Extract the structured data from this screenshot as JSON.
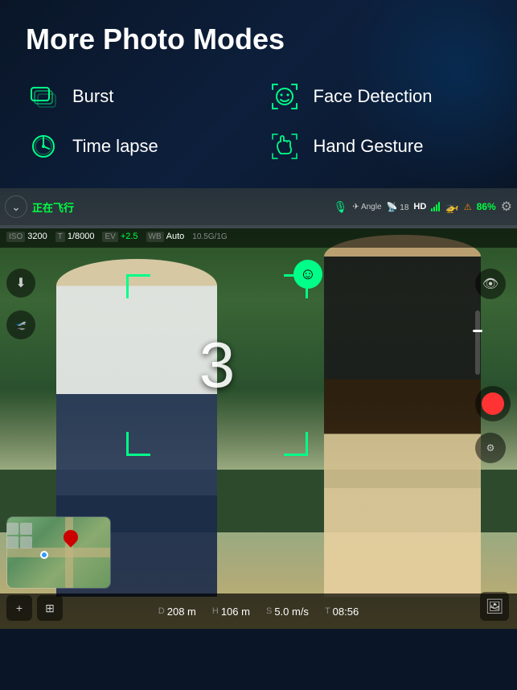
{
  "header": {
    "title": "More Photo Modes"
  },
  "modes": [
    {
      "id": "burst",
      "label": "Burst",
      "icon": "burst-icon",
      "iconColor": "#00ff88"
    },
    {
      "id": "face-detection",
      "label": "Face Detection",
      "icon": "face-detection-icon",
      "iconColor": "#00ff88"
    },
    {
      "id": "time-lapse",
      "label": "Time lapse",
      "icon": "time-lapse-icon",
      "iconColor": "#00ff88"
    },
    {
      "id": "hand-gesture",
      "label": "Hand Gesture",
      "icon": "hand-gesture-icon",
      "iconColor": "#00ff88"
    }
  ],
  "camera": {
    "hud": {
      "flying_status": "正在飞行",
      "angle_label": "Angle",
      "angle_icon": "angle-icon",
      "satellite_count": "18",
      "quality": "HD",
      "signal_bars": 4,
      "battery_percent": "86%",
      "iso_label": "ISO",
      "iso_value": "3200",
      "shutter_label": "T",
      "shutter_value": "1/8000",
      "ev_label": "EV",
      "ev_value": "+2.5",
      "wb_label": "WB",
      "wb_value": "Auto",
      "network": "10.5G/1G"
    },
    "face_detect": {
      "countdown": "3",
      "smiley": "☺"
    },
    "bottom_stats": {
      "d_label": "D",
      "d_value": "208 m",
      "h_label": "H",
      "h_value": "106 m",
      "s_label": "S",
      "s_value": "5.0 m/s",
      "t_label": "T",
      "t_value": "08:56"
    }
  }
}
